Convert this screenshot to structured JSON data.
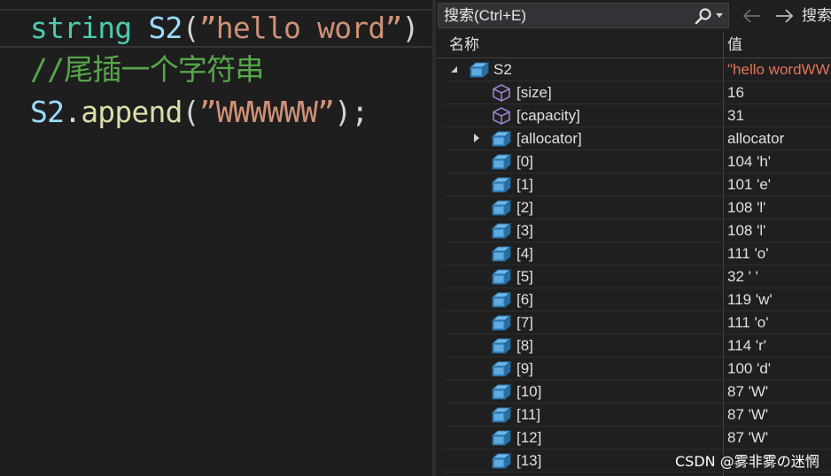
{
  "editor": {
    "line1": {
      "type": "string",
      "var": "S2",
      "open": "(",
      "literal": "”hello word”",
      "close": ")"
    },
    "line2": {
      "comment": "//尾插一个字符串"
    },
    "line3": {
      "var": "S2",
      "dot": ".",
      "method": "append",
      "open": "(",
      "literal": "”WWWWWW”",
      "close": ");"
    }
  },
  "watch": {
    "search": {
      "placeholder": "搜索(Ctrl+E)",
      "depth_label": "搜索"
    },
    "header": {
      "name": "名称",
      "value": "值"
    },
    "rows": [
      {
        "name": "S2",
        "value": "\"hello wordWW",
        "icon": "object-icon",
        "expander": "open"
      },
      {
        "name": "[size]",
        "value": "16",
        "icon": "property-icon"
      },
      {
        "name": "[capacity]",
        "value": "31",
        "icon": "property-icon"
      },
      {
        "name": "[allocator]",
        "value": "allocator",
        "icon": "object-icon",
        "expander": "closed"
      },
      {
        "name": "[0]",
        "value": "104 'h'",
        "icon": "object-icon"
      },
      {
        "name": "[1]",
        "value": "101 'e'",
        "icon": "object-icon"
      },
      {
        "name": "[2]",
        "value": "108 'l'",
        "icon": "object-icon"
      },
      {
        "name": "[3]",
        "value": "108 'l'",
        "icon": "object-icon"
      },
      {
        "name": "[4]",
        "value": "111 'o'",
        "icon": "object-icon"
      },
      {
        "name": "[5]",
        "value": "32 ' '",
        "icon": "object-icon"
      },
      {
        "name": "[6]",
        "value": "119 'w'",
        "icon": "object-icon"
      },
      {
        "name": "[7]",
        "value": "111 'o'",
        "icon": "object-icon"
      },
      {
        "name": "[8]",
        "value": "114 'r'",
        "icon": "object-icon"
      },
      {
        "name": "[9]",
        "value": "100 'd'",
        "icon": "object-icon"
      },
      {
        "name": "[10]",
        "value": "87 'W'",
        "icon": "object-icon"
      },
      {
        "name": "[11]",
        "value": "87 'W'",
        "icon": "object-icon"
      },
      {
        "name": "[12]",
        "value": "87 'W'",
        "icon": "object-icon"
      },
      {
        "name": "[13]",
        "value": "",
        "icon": "object-icon"
      }
    ]
  },
  "watermark": "CSDN @雾非雾の迷惘",
  "colors": {
    "string_value": "#e3735b",
    "object_icon": "#4f9fd8",
    "property_icon": "#9b7fd0"
  }
}
